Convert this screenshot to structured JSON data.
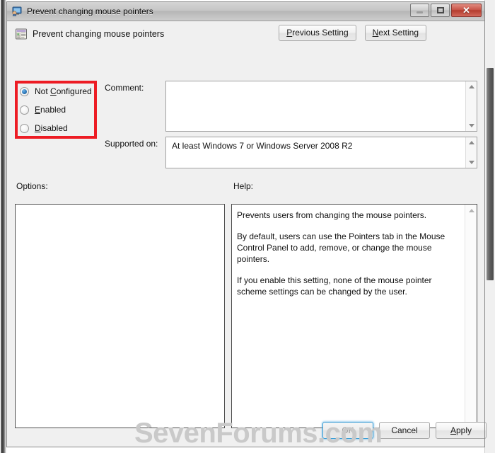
{
  "window": {
    "title": "Prevent changing mouse pointers",
    "icon": "mouse-pointer-policy-icon",
    "controls": {
      "minimize": "minimize-icon",
      "maximize": "maximize-icon",
      "close": "✕"
    }
  },
  "header": {
    "policy_icon": "policy-setting-icon",
    "policy_title": "Prevent changing mouse pointers",
    "previous_setting": "Previous Setting",
    "previous_setting_pre": "P",
    "previous_setting_post": "revious Setting",
    "next_setting": "Next Setting",
    "next_setting_pre": "N",
    "next_setting_post": "ext Setting"
  },
  "state": {
    "selected": "Not Configured",
    "options": [
      {
        "label": "Not Configured",
        "pre": "Not ",
        "accel": "C",
        "post": "onfigured",
        "checked": true
      },
      {
        "label": "Enabled",
        "pre": "",
        "accel": "E",
        "post": "nabled",
        "checked": false
      },
      {
        "label": "Disabled",
        "pre": "",
        "accel": "D",
        "post": "isabled",
        "checked": false
      }
    ],
    "highlight_color": "#ed1c24"
  },
  "comment": {
    "label": "Comment:",
    "value": "",
    "placeholder": ""
  },
  "supported": {
    "label": "Supported on:",
    "value": "At least Windows 7 or Windows Server 2008 R2"
  },
  "options_panel": {
    "label": "Options:",
    "content": ""
  },
  "help_panel": {
    "label": "Help:",
    "paragraphs": [
      "Prevents users from changing the mouse pointers.",
      "By default, users can use the Pointers tab in the Mouse Control Panel to add, remove, or change the mouse pointers.",
      "If you enable this setting, none of the mouse pointer scheme settings can be changed by the user."
    ]
  },
  "watermark": {
    "text": "SevenForums.com"
  },
  "footer": {
    "ok": "OK",
    "cancel": "Cancel",
    "apply": "Apply",
    "apply_pre": "A",
    "apply_post": "pply",
    "ok_enabled": false
  }
}
